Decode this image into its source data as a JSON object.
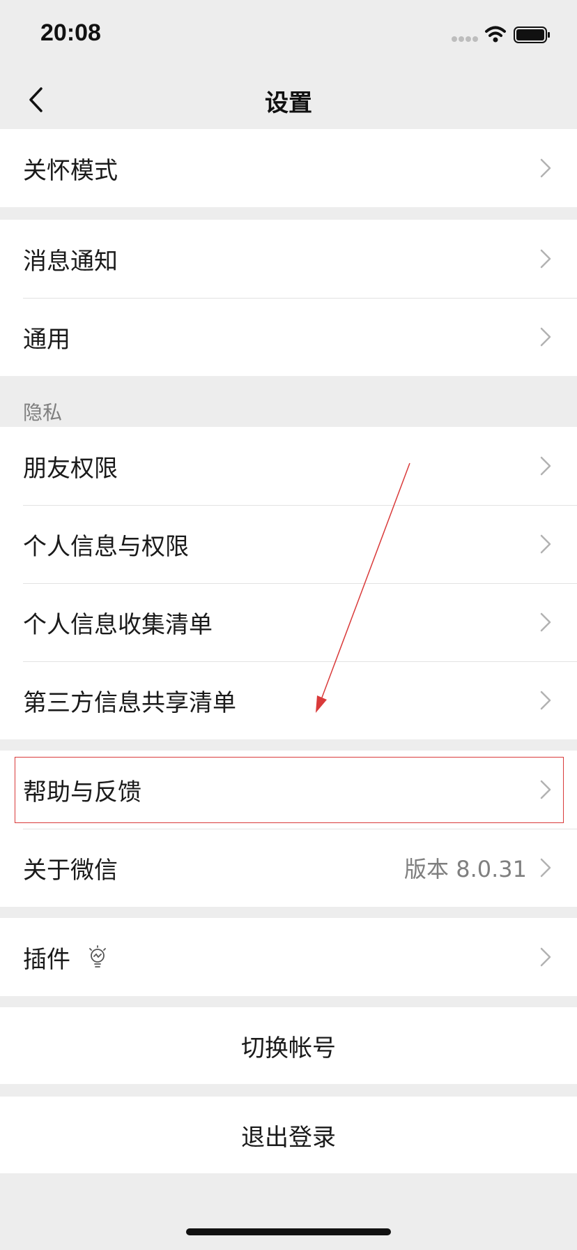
{
  "status_bar": {
    "time": "20:08"
  },
  "nav": {
    "title": "设置"
  },
  "groups": {
    "care": {
      "items": [
        {
          "label": "关怀模式"
        }
      ]
    },
    "general": {
      "items": [
        {
          "label": "消息通知"
        },
        {
          "label": "通用"
        }
      ]
    },
    "privacy": {
      "header": "隐私",
      "items": [
        {
          "label": "朋友权限"
        },
        {
          "label": "个人信息与权限"
        },
        {
          "label": "个人信息收集清单"
        },
        {
          "label": "第三方信息共享清单"
        }
      ]
    },
    "about": {
      "items": [
        {
          "label": "帮助与反馈"
        },
        {
          "label": "关于微信",
          "value": "版本 8.0.31"
        }
      ]
    },
    "plugins": {
      "items": [
        {
          "label": "插件"
        }
      ]
    }
  },
  "actions": {
    "switch_account": "切换帐号",
    "logout": "退出登录"
  },
  "colors": {
    "background": "#ededed",
    "row_background": "#ffffff",
    "annotation": "#d93a3a",
    "secondary_text": "#7f7f7f"
  },
  "icons": {
    "back": "chevron-left-icon",
    "row_disclosure": "chevron-right-icon",
    "plugin": "lightbulb-icon"
  }
}
